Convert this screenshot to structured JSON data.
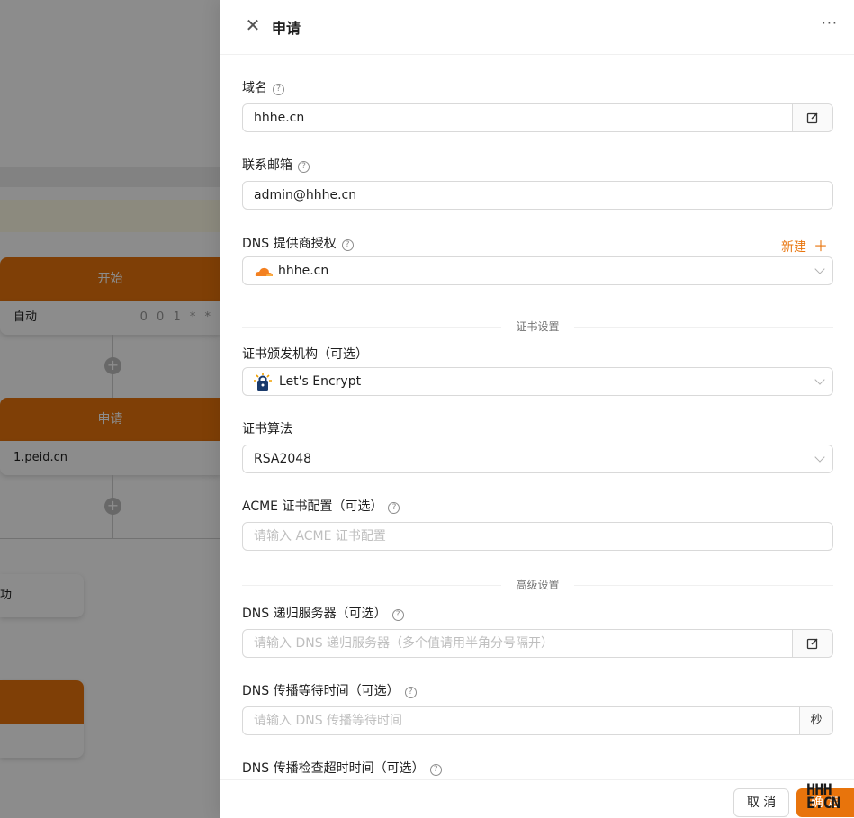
{
  "background": {
    "nodes": [
      {
        "header": "开始",
        "body": "自动",
        "sub": "0 0 1 * *"
      },
      {
        "header": "申请",
        "body": "1.peid.cn"
      }
    ],
    "partial_label": "功"
  },
  "drawer": {
    "title": "申请",
    "more": "···",
    "fields": {
      "domain": {
        "label": "域名",
        "value": "hhhe.cn"
      },
      "email": {
        "label": "联系邮箱",
        "value": "admin@hhhe.cn"
      },
      "dns_auth": {
        "label": "DNS 提供商授权",
        "new_label": "新建",
        "value": "hhhe.cn"
      },
      "ca": {
        "label": "证书颁发机构（可选）",
        "value": "Let's Encrypt"
      },
      "algorithm": {
        "label": "证书算法",
        "value": "RSA2048"
      },
      "acme": {
        "label": "ACME 证书配置（可选）",
        "placeholder": "请输入 ACME 证书配置"
      },
      "dns_resolver": {
        "label": "DNS 递归服务器（可选）",
        "placeholder": "请输入 DNS 递归服务器（多个值请用半角分号隔开）"
      },
      "dns_wait": {
        "label": "DNS 传播等待时间（可选）",
        "placeholder": "请输入 DNS 传播等待时间",
        "unit": "秒"
      },
      "dns_timeout": {
        "label": "DNS 传播检查超时时间（可选）"
      }
    },
    "dividers": {
      "cert_settings": "证书设置",
      "advanced_settings": "高级设置"
    },
    "footer": {
      "cancel": "取 消",
      "ok": "确 定",
      "watermark_top": "HHH",
      "watermark_bottom": "E.CN"
    }
  },
  "colors": {
    "accent": "#e8740c",
    "mask": "rgba(0,0,0,0.45)"
  },
  "icons": {
    "close": "close-icon",
    "help": "question-circle-icon",
    "edit": "edit-icon",
    "cloudflare": "cloudflare-icon",
    "letsencrypt": "letsencrypt-icon",
    "plus": "plus-icon",
    "chevron": "chevron-down-icon"
  }
}
